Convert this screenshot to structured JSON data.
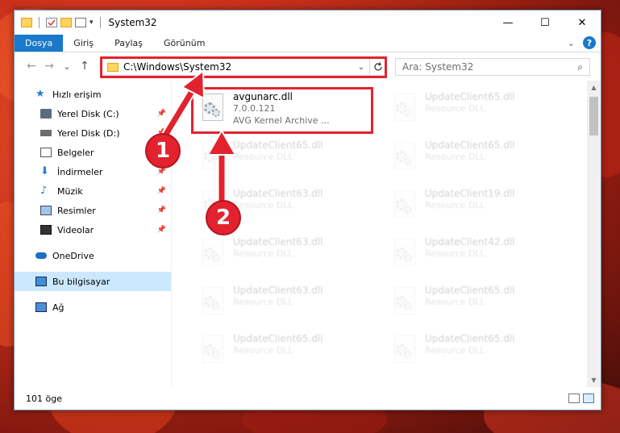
{
  "window": {
    "title": "System32",
    "controls": {
      "minimize": "—",
      "maximize": "☐",
      "close": "✕"
    }
  },
  "ribbon": {
    "tabs": [
      "Dosya",
      "Giriş",
      "Paylaş",
      "Görünüm"
    ],
    "expand_icon": "chevron-down-icon",
    "help": "?"
  },
  "navigation": {
    "back": "←",
    "forward": "→",
    "recent": "⌄",
    "up": "↑",
    "address": "C:\\Windows\\System32",
    "search_placeholder": "Ara: System32",
    "search_icon": "⌕"
  },
  "sidebar": {
    "items": [
      {
        "label": "Hızlı erişim",
        "icon": "star-icon",
        "pinned": false
      },
      {
        "label": "Yerel Disk (C:)",
        "icon": "drive-icon",
        "pinned": true
      },
      {
        "label": "Yerel Disk (D:)",
        "icon": "drive-icon",
        "pinned": true
      },
      {
        "label": "Belgeler",
        "icon": "documents-icon",
        "pinned": true
      },
      {
        "label": "İndirmeler",
        "icon": "download-icon",
        "pinned": true
      },
      {
        "label": "Müzik",
        "icon": "music-icon",
        "pinned": true
      },
      {
        "label": "Resimler",
        "icon": "pictures-icon",
        "pinned": true
      },
      {
        "label": "Videolar",
        "icon": "video-icon",
        "pinned": true
      },
      {
        "label": "OneDrive",
        "icon": "cloud-icon",
        "pinned": false
      },
      {
        "label": "Bu bilgisayar",
        "icon": "computer-icon",
        "pinned": false
      },
      {
        "label": "Ağ",
        "icon": "network-icon",
        "pinned": false
      }
    ]
  },
  "files": [
    {
      "name": "avgunarc.dll",
      "version": "7.0.0.121",
      "desc": "AVG Kernel Archive ..."
    },
    {
      "name": "UpdateClient65.dll",
      "desc": "Resource DLL"
    },
    {
      "name": "UpdateClient65.dll",
      "desc": "Resource DLL"
    },
    {
      "name": "UpdateClient65.dll",
      "desc": "Resource DLL"
    },
    {
      "name": "UpdateClient63.dll",
      "desc": "Resource DLL"
    },
    {
      "name": "UpdateClient19.dll",
      "desc": "Resource DLL"
    },
    {
      "name": "UpdateClient63.dll",
      "desc": "Resource DLL"
    },
    {
      "name": "UpdateClient42.dll",
      "desc": "Resource DLL"
    },
    {
      "name": "UpdateClient63.dll",
      "desc": "Resource DLL"
    },
    {
      "name": "UpdateClient65.dll",
      "desc": "Resource DLL"
    },
    {
      "name": "UpdateClient65.dll",
      "desc": "Resource DLL"
    },
    {
      "name": "UpdateClient65.dll",
      "desc": "Resource DLL"
    }
  ],
  "status": {
    "count": "101 öge"
  },
  "annotations": {
    "step1": "1",
    "step2": "2"
  },
  "colors": {
    "accent": "#1979ca",
    "highlight": "#e2232f",
    "selected": "#cce8ff"
  }
}
